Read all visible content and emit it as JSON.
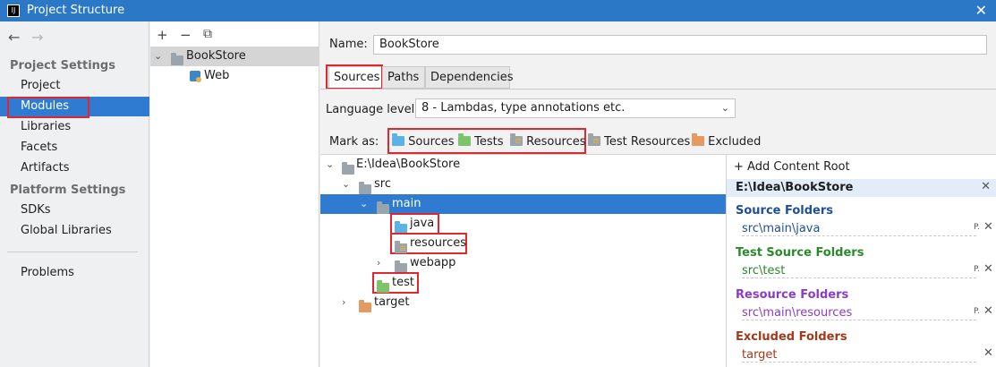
{
  "window": {
    "title": "Project Structure",
    "app_icon": "IJ"
  },
  "nav": {
    "back_label": "←",
    "forward_label": "→",
    "project_settings_header": "Project Settings",
    "project_items": [
      "Project",
      "Modules",
      "Libraries",
      "Facets",
      "Artifacts"
    ],
    "platform_settings_header": "Platform Settings",
    "platform_items": [
      "SDKs",
      "Global Libraries"
    ],
    "problems": "Problems",
    "selected": "Modules"
  },
  "modules": {
    "toolbar": {
      "add": "+",
      "remove": "−",
      "copy": "⧉"
    },
    "items": [
      {
        "name": "BookStore"
      },
      {
        "name": "Web"
      }
    ]
  },
  "detail": {
    "name_label": "Name:",
    "name_value": "BookStore",
    "tabs": [
      "Sources",
      "Paths",
      "Dependencies"
    ],
    "active_tab": "Sources",
    "language_level_label": "Language level:",
    "language_level_value": "8 - Lambdas, type annotations etc.",
    "mark_as_label": "Mark as:",
    "mark_as": [
      "Sources",
      "Tests",
      "Resources",
      "Test Resources",
      "Excluded"
    ],
    "tree": {
      "root": "E:\\Idea\\BookStore",
      "src": "src",
      "main": "main",
      "java": "java",
      "resources": "resources",
      "webapp": "webapp",
      "test": "test",
      "target": "target"
    }
  },
  "content_roots": {
    "add_label": "+ Add Content Root",
    "root_path": "E:\\Idea\\BookStore",
    "groups": [
      {
        "title": "Source Folders",
        "color": "#1f4e9a",
        "path": "src\\main\\java"
      },
      {
        "title": "Test Source Folders",
        "color": "#2a8a2a",
        "path": "src\\test"
      },
      {
        "title": "Resource Folders",
        "color": "#8a3cc9",
        "path": "src\\main\\resources"
      },
      {
        "title": "Excluded Folders",
        "color": "#a23a1b",
        "path": "target"
      }
    ]
  },
  "colors": {
    "titlebar": "#2a78c6",
    "selection": "#2e7bd1",
    "highlight_box": "#e2262f"
  }
}
